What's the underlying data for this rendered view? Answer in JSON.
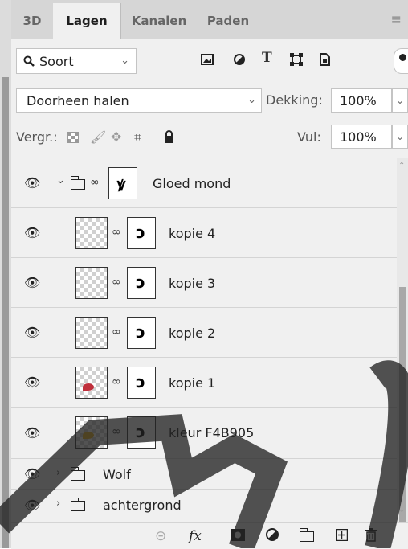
{
  "tabs": [
    "3D",
    "Lagen",
    "Kanalen",
    "Paden"
  ],
  "active_tab": "Lagen",
  "filter": {
    "label": "Soort",
    "icons": [
      "image-filter-icon",
      "adjustment-filter-icon",
      "text-filter-icon",
      "shape-filter-icon",
      "smart-object-filter-icon"
    ]
  },
  "blend_mode": "Doorheen halen",
  "opacity": {
    "label": "Dekking:",
    "value": "100%"
  },
  "lock": {
    "label": "Vergr.:"
  },
  "fill": {
    "label": "Vul:",
    "value": "100%"
  },
  "layers": [
    {
      "name": "Gloed mond",
      "type": "group",
      "expanded": true,
      "thumb": "none",
      "mask_glyph": "ꝟ"
    },
    {
      "name": "kopie 4",
      "type": "layer",
      "thumb": "transparent",
      "mask_glyph": "ↄ"
    },
    {
      "name": "kopie 3",
      "type": "layer",
      "thumb": "transparent",
      "mask_glyph": "ↄ"
    },
    {
      "name": "kopie 2",
      "type": "layer",
      "thumb": "transparent",
      "mask_glyph": "ↄ"
    },
    {
      "name": "kopie 1",
      "type": "layer",
      "thumb": "red",
      "thumb_color": "#c0303c",
      "mask_glyph": "ↄ"
    },
    {
      "name": "kleur F4B905",
      "type": "layer",
      "thumb": "yellow",
      "thumb_color": "#e8b020",
      "mask_glyph": "ↄ"
    },
    {
      "name": "Wolf",
      "type": "group",
      "expanded": false
    },
    {
      "name": "achtergrond",
      "type": "group",
      "expanded": false
    }
  ],
  "bottom_icons": [
    "link-layers-icon",
    "fx-icon",
    "add-mask-icon",
    "adjustment-layer-icon",
    "new-group-icon",
    "new-layer-icon",
    "delete-layer-icon"
  ],
  "colors": {
    "panel_bg": "#f0f0f0",
    "tab_bar": "#d6d6d6",
    "border": "#c4c4c4",
    "watermark": "#222222"
  }
}
